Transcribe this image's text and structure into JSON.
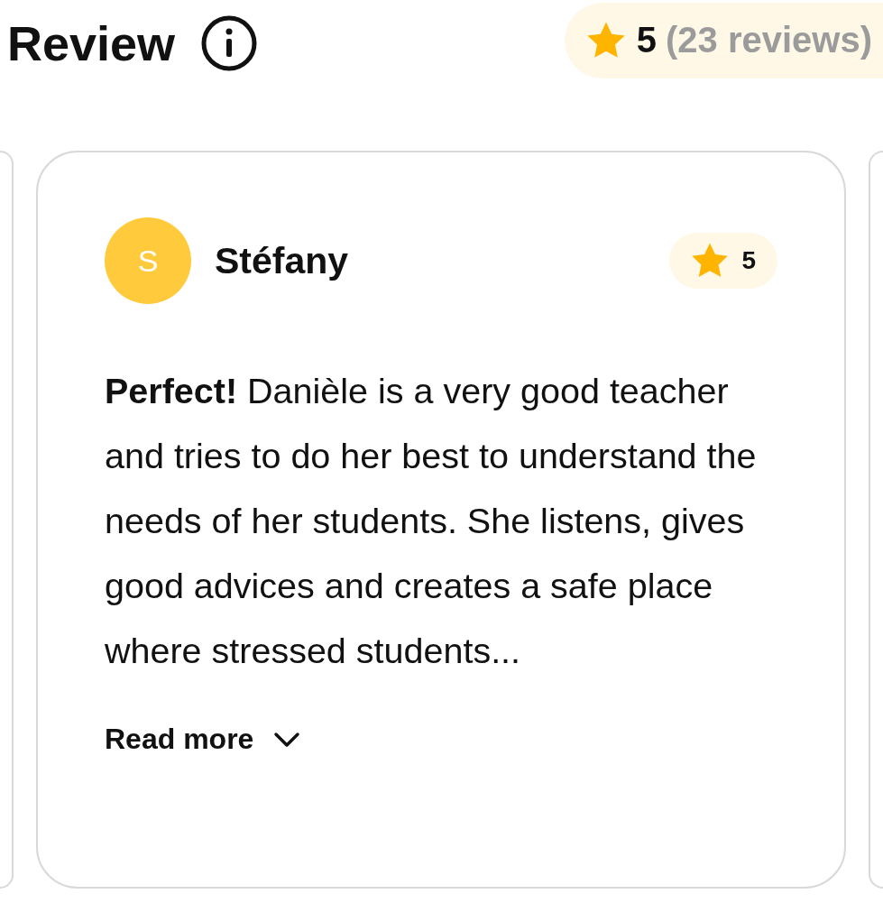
{
  "header": {
    "title": "Review",
    "rating": "5",
    "review_count": "(23 reviews)"
  },
  "review": {
    "avatar_letter": "S",
    "name": "Stéfany",
    "rating": "5",
    "text": "**Perfect!** Danièle is a very good teacher and tries to do her best to understand the needs of her students. She listens, gives good advices and creates a safe place where stressed students...",
    "read_more": "Read more"
  }
}
